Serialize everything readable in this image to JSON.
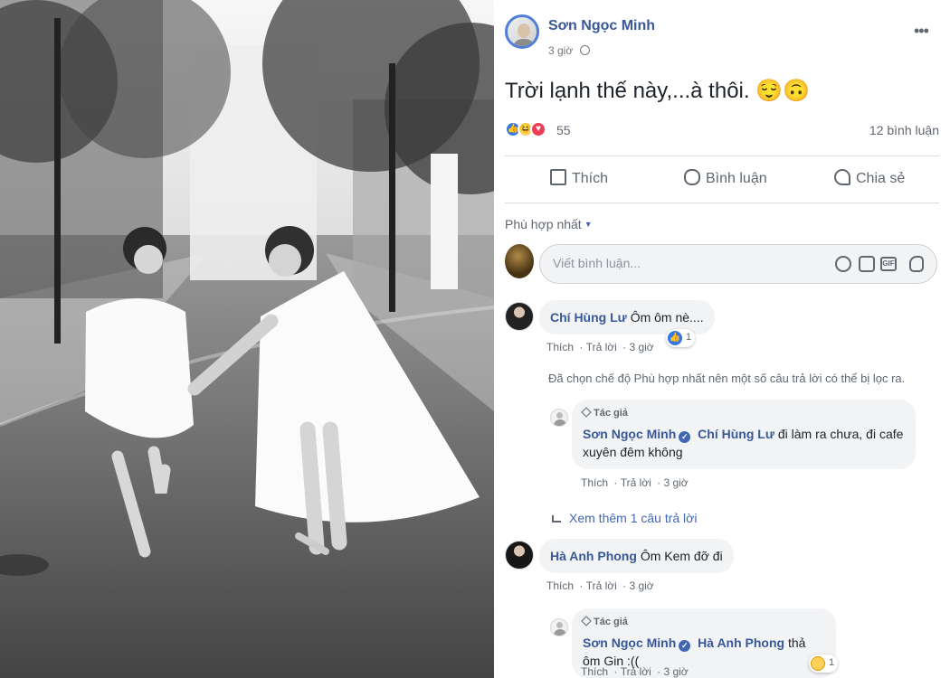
{
  "post": {
    "author": "Sơn Ngọc Minh",
    "time": "3 giờ",
    "text": "Trời lạnh thế này,...à thôi. 😌🙃",
    "reaction_count": "55",
    "comment_count": "12 bình luận",
    "reaction_icons": [
      "like-icon",
      "haha-icon",
      "love-icon"
    ]
  },
  "actions": {
    "like": "Thích",
    "comment": "Bình luận",
    "share": "Chia sẻ"
  },
  "filter": {
    "label": "Phù hợp nhất"
  },
  "composer": {
    "placeholder": "Viết bình luận..."
  },
  "comments": [
    {
      "author": "Chí Hùng Lư",
      "text": "Ôm ôm nè....",
      "like": "Thích",
      "reply": "Trả lời",
      "time": "3 giờ",
      "reaction_count": "1"
    },
    {
      "author": "Hà Anh Phong",
      "text": "Ôm Kem đỡ đi",
      "like": "Thích",
      "reply": "Trả lời",
      "time": "3 giờ"
    }
  ],
  "replies": [
    {
      "author_tag": "Tác giả",
      "author": "Sơn Ngọc Minh",
      "mention": "Chí Hùng Lư",
      "text": "đi làm ra chưa, đi cafe xuyên đêm không",
      "like": "Thích",
      "reply": "Trả lời",
      "time": "3 giờ"
    },
    {
      "author_tag": "Tác giả",
      "author": "Sơn Ngọc Minh",
      "mention": "Hà Anh Phong",
      "text": "thả ôm Gin :((",
      "like": "Thích",
      "reply": "Trả lời",
      "time": "3 giờ",
      "reaction_count": "1"
    }
  ],
  "notices": {
    "filtered": "Đã chọn chế độ Phù hợp nhất nên một số câu trả lời có thể bị lọc ra.",
    "more_replies": "Xem thêm 1 câu trả lời"
  }
}
